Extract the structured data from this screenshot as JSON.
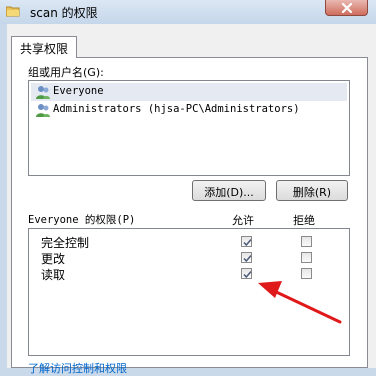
{
  "window": {
    "title": "scan 的权限"
  },
  "tabs": [
    {
      "label": "共享权限"
    }
  ],
  "groups": {
    "label": "组或用户名(G):",
    "items": [
      {
        "name": "Everyone",
        "selected": true
      },
      {
        "name": "Administrators (hjsa-PC\\Administrators)",
        "selected": false
      }
    ]
  },
  "buttons": {
    "add": "添加(D)...",
    "remove": "删除(R)"
  },
  "permissions": {
    "label": "Everyone 的权限(P)",
    "allow_header": "允许",
    "deny_header": "拒绝",
    "rows": [
      {
        "name": "完全控制",
        "allow": true,
        "deny": false
      },
      {
        "name": "更改",
        "allow": true,
        "deny": false
      },
      {
        "name": "读取",
        "allow": true,
        "deny": false
      }
    ]
  },
  "footer_link": "了解访问控制和权限",
  "colors": {
    "arrow": "#e0191b",
    "titlebar": "#c9d9ea",
    "close_button": "#cf6d5e",
    "link": "#0066cc"
  }
}
